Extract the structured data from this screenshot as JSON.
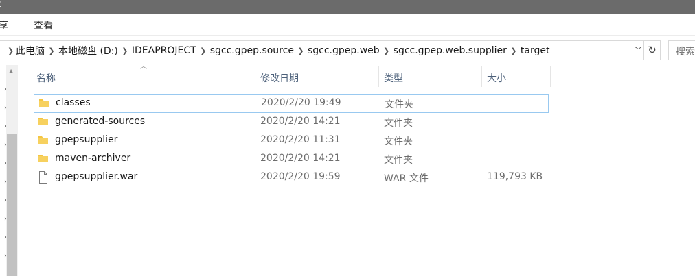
{
  "window": {
    "title": "t"
  },
  "ribbon": {
    "tabs": [
      "享",
      "查看"
    ]
  },
  "address": {
    "crumbs": [
      "此电脑",
      "本地磁盘 (D:)",
      "IDEAPROJECT",
      "sgcc.gpep.source",
      "sgcc.gpep.web",
      "sgcc.gpep.web.supplier",
      "target"
    ],
    "separator_icon": "chevron-right-icon",
    "dropdown_icon": "chevron-down-icon",
    "refresh_icon": "refresh-icon"
  },
  "search": {
    "placeholder": "搜索"
  },
  "columns": {
    "name": "名称",
    "date": "修改日期",
    "type": "类型",
    "size": "大小"
  },
  "files": [
    {
      "icon": "folder-icon",
      "name": "classes",
      "date": "2020/2/20 19:49",
      "type": "文件夹",
      "size": "",
      "selected": true
    },
    {
      "icon": "folder-icon",
      "name": "generated-sources",
      "date": "2020/2/20 14:21",
      "type": "文件夹",
      "size": ""
    },
    {
      "icon": "folder-icon",
      "name": "gpepsupplier",
      "date": "2020/2/20 11:31",
      "type": "文件夹",
      "size": ""
    },
    {
      "icon": "folder-icon",
      "name": "maven-archiver",
      "date": "2020/2/20 14:21",
      "type": "文件夹",
      "size": ""
    },
    {
      "icon": "file-icon",
      "name": "gpepsupplier.war",
      "date": "2020/2/20 19:59",
      "type": "WAR 文件",
      "size": "119,793 KB"
    }
  ],
  "colors": {
    "folder": "#f4c542",
    "selection_border": "#99c9f0",
    "header_text": "#4c607a"
  }
}
